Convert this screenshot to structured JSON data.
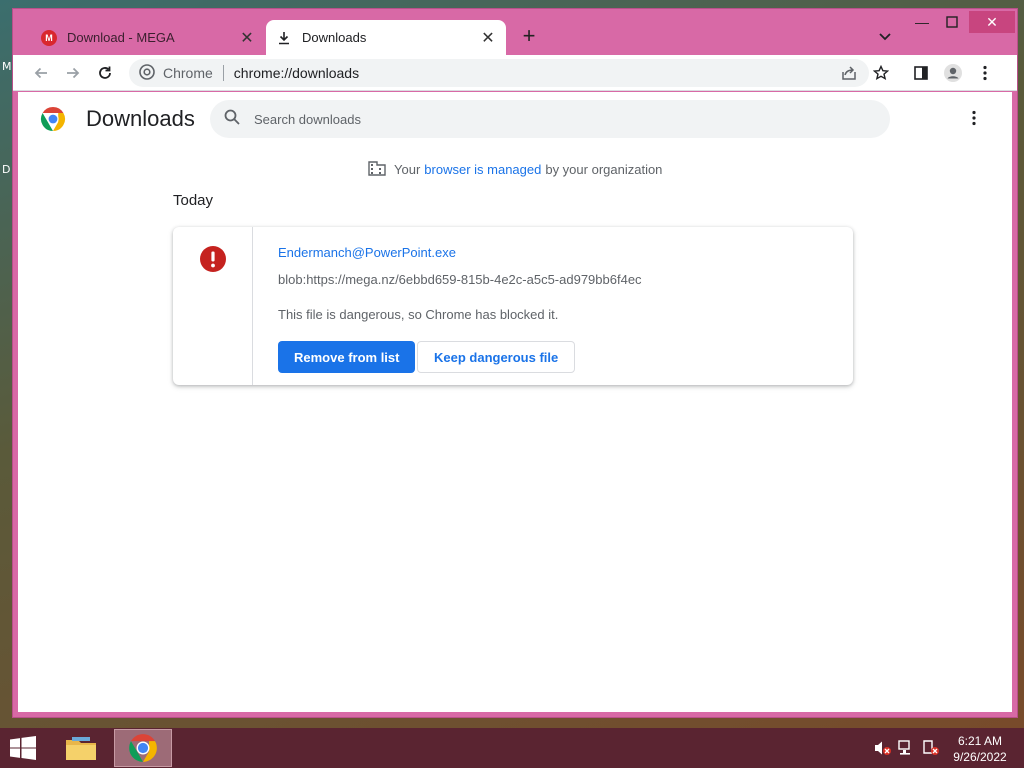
{
  "desktop": {
    "glyph_top": "M",
    "glyph_mid": "D"
  },
  "tabs": [
    {
      "title": "Download - MEGA",
      "favicon": "mega-icon",
      "active": false
    },
    {
      "title": "Downloads",
      "favicon": "download-icon",
      "active": true
    }
  ],
  "window_controls": {
    "minimize": "—",
    "close": "✕"
  },
  "omnibox": {
    "chip": "Chrome",
    "url": "chrome://downloads"
  },
  "page": {
    "title": "Downloads",
    "search_placeholder": "Search downloads",
    "managed_prefix": "Your",
    "managed_link": "browser is managed",
    "managed_suffix": "by your organization",
    "date_header": "Today"
  },
  "download": {
    "filename": "Endermanch@PowerPoint.exe",
    "url": "blob:https://mega.nz/6ebbd659-815b-4e2c-a5c5-ad979bb6f4ec",
    "status": "This file is dangerous, so Chrome has blocked it.",
    "primary_action": "Remove from list",
    "secondary_action": "Keep dangerous file"
  },
  "taskbar": {
    "time": "6:21 AM",
    "date": "9/26/2022"
  },
  "colors": {
    "frame": "#d869a6",
    "accent": "#1a73e8",
    "danger": "#c5221f",
    "taskbar": "#5a2431"
  }
}
